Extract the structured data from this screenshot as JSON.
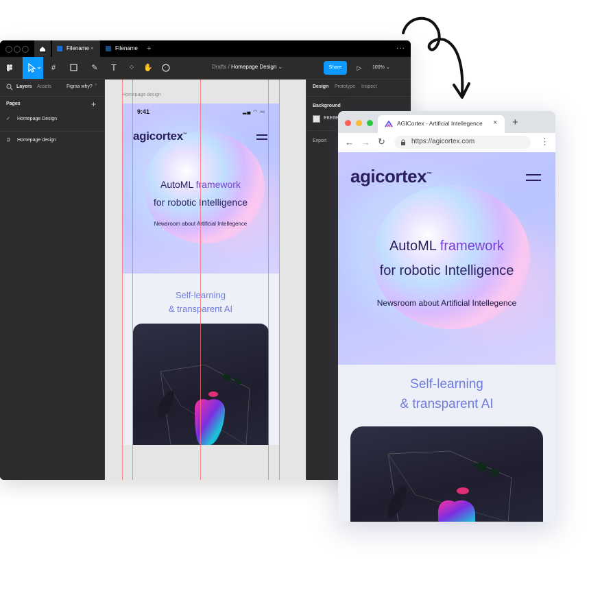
{
  "figma": {
    "tabs": [
      {
        "label": "Filename"
      },
      {
        "label": "Filename"
      }
    ],
    "toolbar": {
      "breadcrumb_parent": "Drafts",
      "breadcrumb_sep": "/",
      "breadcrumb_page": "Homepage Design",
      "share_label": "Share",
      "zoom": "100%"
    },
    "left_panel": {
      "tabs": [
        "Layers",
        "Assets"
      ],
      "file_label": "Figma why?",
      "pages_title": "Pages",
      "pages": [
        "Homepage Design"
      ],
      "layers": [
        "Homepage design"
      ]
    },
    "canvas": {
      "frame_label": "Homepage design",
      "status_time": "9:41",
      "logo": "agicortex",
      "logo_tm": "™",
      "hero_line1_a": "AutoML",
      "hero_line1_b": "framework",
      "hero_line2": "for robotic Intelligence",
      "hero_sub_a": "Newsroom about",
      "hero_sub_b": "Artificial Intellegence",
      "section_line1": "Self-learning",
      "section_line2": "& transparent AI"
    },
    "right_panel": {
      "tabs": [
        "Design",
        "Prototype",
        "Inspect"
      ],
      "background_title": "Background",
      "background_hex": "E6E6E6",
      "export_title": "Export"
    }
  },
  "browser": {
    "tab_title": "AGICortex - Artificial Intellegence",
    "new_tab": "+",
    "url": "https://agicortex.com",
    "logo": "agicortex",
    "logo_tm": "™",
    "hero_line1_a": "AutoML",
    "hero_line1_b": "framework",
    "hero_line2": "for robotic Intelligence",
    "hero_sub_a": "Newsroom about",
    "hero_sub_b": "Artificial Intellegence",
    "section_line1": "Self-learning",
    "section_line2": "& transparent AI"
  },
  "colors": {
    "figma_dark": "#2c2c2c",
    "share_blue": "#0d99ff",
    "accent_purple": "#7b3fd6",
    "title_navy": "#2a1f5c",
    "section_blue": "#6e7be0"
  }
}
